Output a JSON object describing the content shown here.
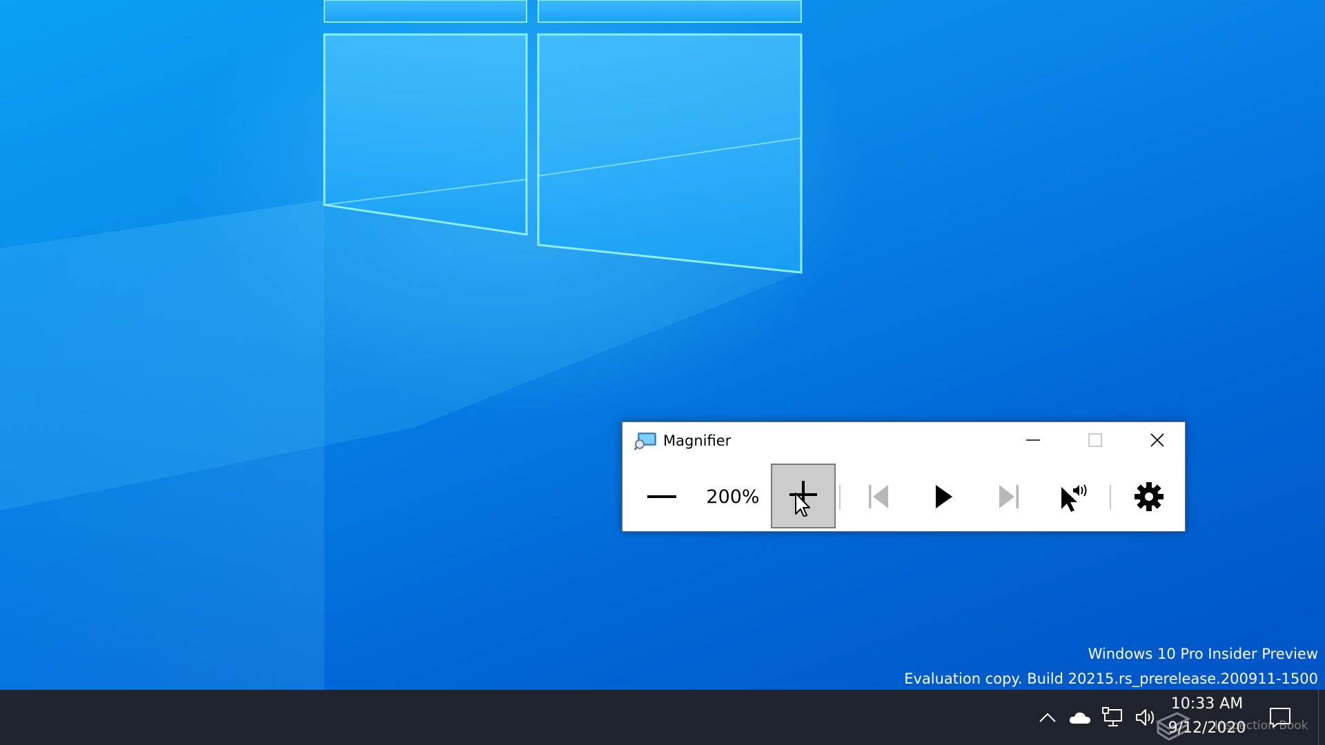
{
  "desktop": {
    "watermark_line1": "Windows 10 Pro Insider Preview",
    "watermark_line2": "Evaluation copy. Build 20215.rs_prerelease.200911-1500"
  },
  "magnifier": {
    "title": "Magnifier",
    "app_icon": "magnifier-app-icon",
    "caption": {
      "minimize_icon": "minimize-icon",
      "maximize_icon": "maximize-icon",
      "close_icon": "close-icon"
    },
    "toolbar": {
      "zoom_out_icon": "minus-icon",
      "zoom_level": "200%",
      "zoom_in_icon": "plus-icon",
      "previous_icon": "skip-previous-icon",
      "play_icon": "play-icon",
      "next_icon": "skip-next-icon",
      "read_from_here_icon": "pointer-speaker-icon",
      "settings_icon": "gear-icon"
    }
  },
  "taskbar": {
    "tray_icons": [
      "chevron-up-icon",
      "onedrive-cloud-icon",
      "network-icon",
      "volume-icon"
    ],
    "clock": {
      "time": "10:33 AM",
      "date": "9/12/2020"
    },
    "action_center_icon": "notification-icon",
    "overlay_brand": "Inspection Book"
  },
  "colors": {
    "desktop_blue": "#0078d7",
    "taskbar": "#1f232b",
    "window_bg": "#ffffff",
    "pressed_button": "#cccccc"
  }
}
